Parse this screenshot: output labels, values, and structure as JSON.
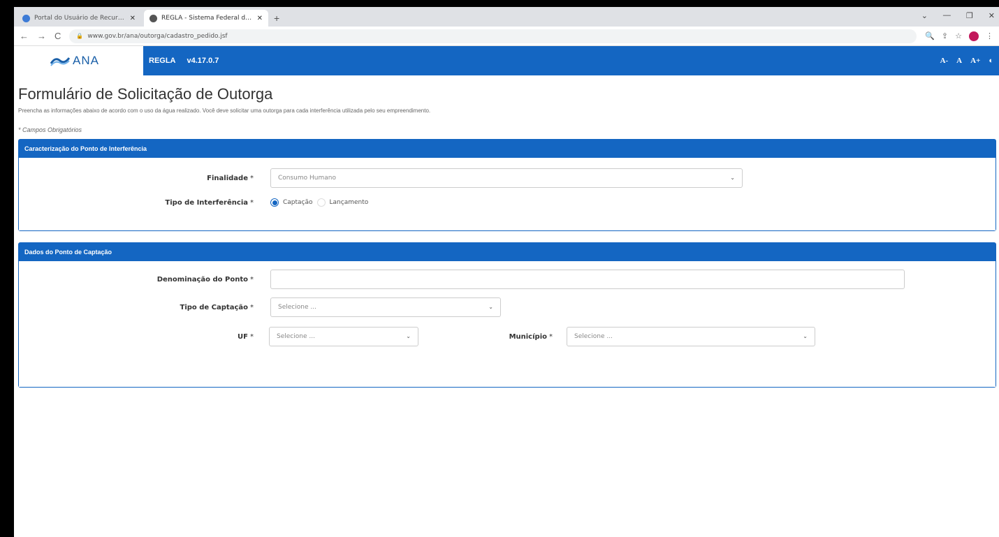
{
  "browser": {
    "tabs": [
      {
        "title": "Portal do Usuário de Recursos H",
        "close": "✕",
        "active": false
      },
      {
        "title": "REGLA - Sistema Federal de Reg",
        "close": "✕",
        "active": true
      }
    ],
    "new_tab": "+",
    "window_controls": {
      "down": "⌄",
      "minimize": "—",
      "restore": "❐",
      "close": "✕"
    },
    "url": "www.gov.br/ana/outorga/cadastro_pedido.jsf"
  },
  "app": {
    "logo_text": "ANA",
    "system_name": "REGLA",
    "version": "v4.17.0.7",
    "font_controls": [
      "A-",
      "A",
      "A+",
      "◐"
    ]
  },
  "page": {
    "title": "Formulário de Solicitação de Outorga",
    "description": "Preencha as informações abaixo de acordo com o uso da água realizado. Você deve solicitar uma outorga para cada interferência utilizada pelo seu empreendimento.",
    "required_note": "* Campos Obrigatórios"
  },
  "panel1": {
    "heading": "Caracterização do Ponto de Interferência",
    "finalidade_label": "Finalidade",
    "finalidade_value": "Consumo Humano",
    "tipo_label": "Tipo de Interferência",
    "radio_captacao": "Captação",
    "radio_lancamento": "Lançamento",
    "selected": "Captação"
  },
  "panel2": {
    "heading": "Dados do Ponto de Captação",
    "denominacao_label": "Denominação do Ponto",
    "denominacao_value": "",
    "tipo_captacao_label": "Tipo de Captação",
    "tipo_captacao_value": "Selecione ...",
    "uf_label": "UF",
    "uf_value": "Selecione ...",
    "municipio_label": "Município",
    "municipio_value": "Selecione ..."
  },
  "required_marker": "*",
  "colors": {
    "primary": "#1466c2",
    "frame": "#000000"
  }
}
